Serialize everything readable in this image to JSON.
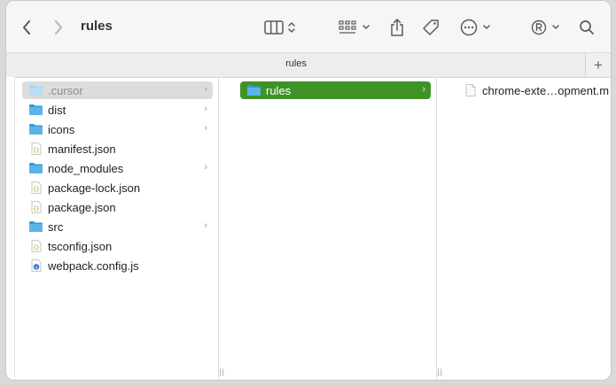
{
  "window": {
    "title": "rules",
    "tab_label": "rules",
    "new_tab_symbol": "+"
  },
  "toolbar": {
    "back_icon": "chevron-left-icon",
    "forward_icon": "chevron-right-icon",
    "view_icon": "columns-view-icon",
    "group_icon": "grid-group-icon",
    "share_icon": "share-icon",
    "tag_icon": "tag-icon",
    "more_icon": "ellipsis-circle-icon",
    "registered_icon": "registered-icon",
    "search_icon": "search-icon"
  },
  "column1": {
    "items": [
      {
        "label": ".cursor",
        "type": "folder",
        "has_children": true,
        "state": "inactive-selected"
      },
      {
        "label": "dist",
        "type": "folder",
        "has_children": true
      },
      {
        "label": "icons",
        "type": "folder",
        "has_children": true
      },
      {
        "label": "manifest.json",
        "type": "json"
      },
      {
        "label": "node_modules",
        "type": "folder",
        "has_children": true
      },
      {
        "label": "package-lock.json",
        "type": "json"
      },
      {
        "label": "package.json",
        "type": "json"
      },
      {
        "label": "src",
        "type": "folder",
        "has_children": true
      },
      {
        "label": "tsconfig.json",
        "type": "json"
      },
      {
        "label": "webpack.config.js",
        "type": "js"
      }
    ]
  },
  "column2": {
    "items": [
      {
        "label": "rules",
        "type": "folder",
        "has_children": true,
        "state": "selected"
      }
    ]
  },
  "column3": {
    "items": [
      {
        "label": "chrome-exte…opment.m",
        "type": "file"
      }
    ]
  },
  "colors": {
    "selection_green": "#3f9326",
    "folder_blue": "#5ab4ea",
    "inactive_selection": "#dcdcdc"
  },
  "chevron_glyph": "›",
  "resize_glyph": "||"
}
